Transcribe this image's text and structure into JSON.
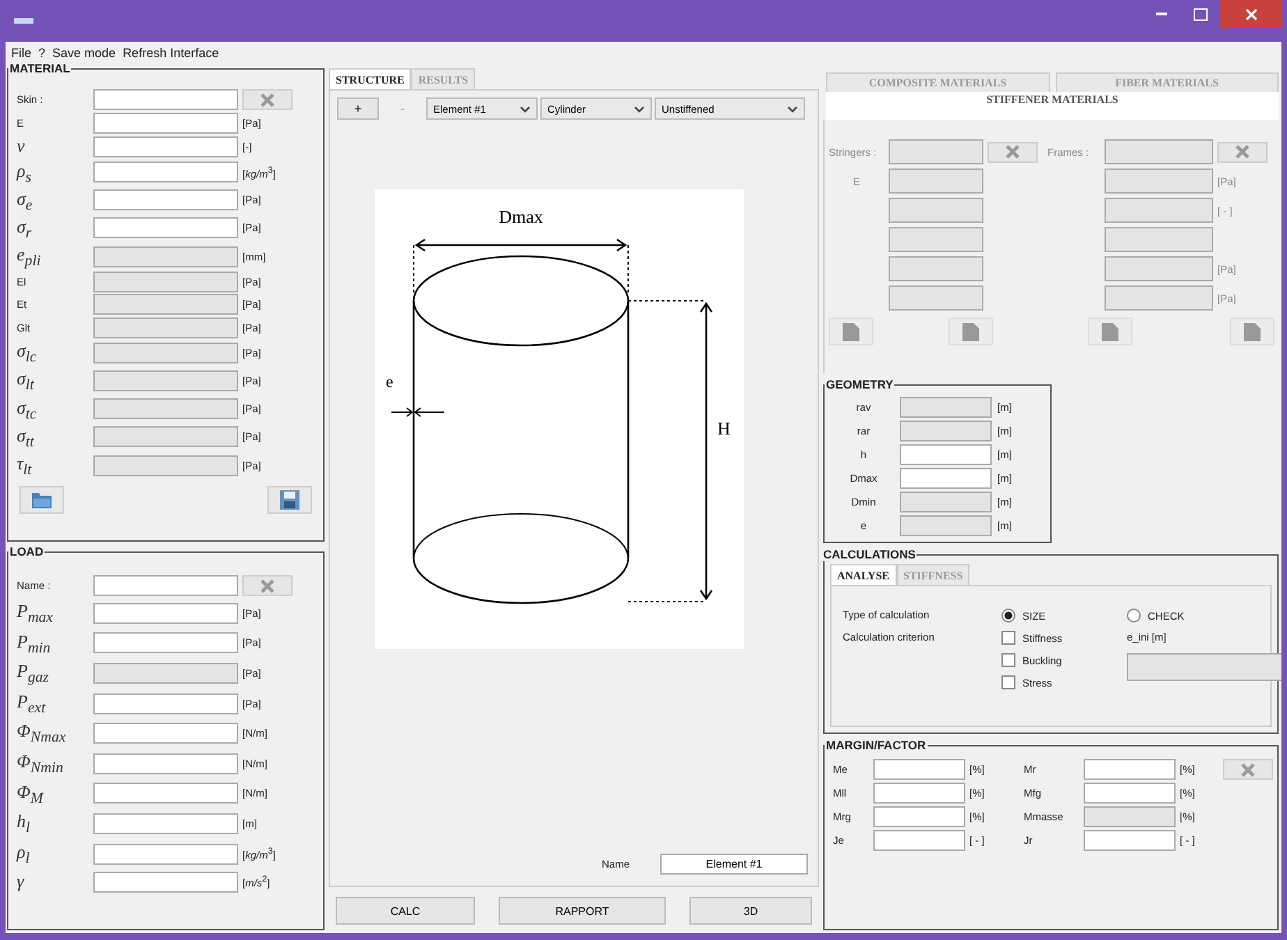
{
  "menu": [
    "File",
    "?",
    "Save mode",
    "Refresh Interface"
  ],
  "material": {
    "title": "MATERIAL",
    "name_label": "Skin :",
    "rows": [
      {
        "label": "E",
        "kind": "plain",
        "unit": "[Pa]",
        "disabled": false
      },
      {
        "label": "ν",
        "kind": "math",
        "unit": "[-]",
        "disabled": false
      },
      {
        "label": "ρ$_{s}$",
        "kind": "math",
        "unit": "[*kg/m*$^{3}$]",
        "disabled": false
      },
      {
        "label": "σ$_{e}$",
        "kind": "math",
        "unit": "[Pa]",
        "disabled": false
      },
      {
        "label": "σ$_{r}$",
        "kind": "math",
        "unit": "[Pa]",
        "disabled": false
      },
      {
        "label": "e$_{pli}$",
        "kind": "math",
        "unit": "[mm]",
        "disabled": true
      },
      {
        "label": "El",
        "kind": "plain",
        "unit": "[Pa]",
        "disabled": true
      },
      {
        "label": "Et",
        "kind": "plain",
        "unit": "[Pa]",
        "disabled": true
      },
      {
        "label": "Glt",
        "kind": "plain",
        "unit": "[Pa]",
        "disabled": true
      },
      {
        "label": "σ$_{lc}$",
        "kind": "math",
        "unit": "[Pa]",
        "disabled": true
      },
      {
        "label": "σ$_{lt}$",
        "kind": "math",
        "unit": "[Pa]",
        "disabled": true
      },
      {
        "label": "σ$_{tc}$",
        "kind": "math",
        "unit": "[Pa]",
        "disabled": true
      },
      {
        "label": "σ$_{tt}$",
        "kind": "math",
        "unit": "[Pa]",
        "disabled": true
      },
      {
        "label": "τ$_{lt}$",
        "kind": "math",
        "unit": "[Pa]",
        "disabled": true
      }
    ]
  },
  "load": {
    "title": "LOAD",
    "name_label": "Name :",
    "rows": [
      {
        "label": "P$_{max}$",
        "kind": "math",
        "unit": "[Pa]",
        "disabled": false
      },
      {
        "label": "P$_{min}$",
        "kind": "math",
        "unit": "[Pa]",
        "disabled": false
      },
      {
        "label": "P$_{gaz}$",
        "kind": "math",
        "unit": "[Pa]",
        "disabled": true
      },
      {
        "label": "P$_{ext}$",
        "kind": "math",
        "unit": "[Pa]",
        "disabled": false
      },
      {
        "label": "Φ$_{Nmax}$",
        "kind": "math",
        "unit": "[N/m]",
        "disabled": false
      },
      {
        "label": "Φ$_{Nmin}$",
        "kind": "math",
        "unit": "[N/m]",
        "disabled": false
      },
      {
        "label": "Φ$_{M}$",
        "kind": "math",
        "unit": "[N/m]",
        "disabled": false
      },
      {
        "label": "h$_{l}$",
        "kind": "math",
        "unit": "[m]",
        "disabled": false
      },
      {
        "label": "ρ$_{l}$",
        "kind": "math",
        "unit": "[*kg/m*$^{3}$]",
        "disabled": false
      },
      {
        "label": "γ",
        "kind": "math",
        "unit": "[*m/s*$^{2}$]",
        "disabled": false
      }
    ]
  },
  "structure": {
    "tabs": [
      {
        "label": "STRUCTURE",
        "selected": true
      },
      {
        "label": "RESULTS",
        "selected": false
      }
    ],
    "tool_buttons": [
      {
        "label": "+",
        "disabled": false
      },
      {
        "label": "-",
        "disabled": true
      }
    ],
    "dropdowns": [
      "Element #1",
      "Cylinder",
      "Unstiffened"
    ],
    "drawing_labels": {
      "width": "Dmax",
      "thickness": "e",
      "height": "H"
    },
    "name_label": "Name",
    "name_value": "Element #1",
    "buttons": [
      "CALC",
      "RAPPORT",
      "3D"
    ]
  },
  "materials_tabs": [
    {
      "label": "COMPOSITE MATERIALS",
      "selected": false
    },
    {
      "label": "FIBER MATERIALS",
      "selected": false
    },
    {
      "label": "STIFFENER MATERIALS",
      "selected": true
    }
  ],
  "stiffener": {
    "left_label": "Stringers :",
    "right_label": "Frames :",
    "rows": [
      {
        "label": "E",
        "unit": "[Pa]"
      },
      {
        "unit": "[ - ]"
      },
      {},
      {
        "unit": "[Pa]"
      },
      {
        "unit": "[Pa]"
      }
    ]
  },
  "geometry": {
    "title": "GEOMETRY",
    "rows": [
      {
        "label": "rav",
        "unit": "[m]",
        "disabled": true
      },
      {
        "label": "rar",
        "unit": "[m]",
        "disabled": true
      },
      {
        "label": "h",
        "unit": "[m]",
        "disabled": false
      },
      {
        "label": "Dmax",
        "unit": "[m]",
        "disabled": false
      },
      {
        "label": "Dmin",
        "unit": "[m]",
        "disabled": true
      },
      {
        "label": "e",
        "unit": "[m]",
        "disabled": true
      }
    ]
  },
  "calculations": {
    "title": "CALCULATIONS",
    "tabs": [
      {
        "label": "ANALYSE",
        "selected": true
      },
      {
        "label": "STIFFNESS",
        "selected": false
      }
    ],
    "type_label": "Type of calculation",
    "radios": [
      {
        "label": "SIZE",
        "selected": true
      },
      {
        "label": "CHECK",
        "selected": false
      }
    ],
    "criterion_label": "Calculation criterion",
    "checks": [
      {
        "label": "Stiffness",
        "checked": false
      },
      {
        "label": "Buckling",
        "checked": false
      },
      {
        "label": "Stress",
        "checked": false
      }
    ],
    "e_ini_label": "e_ini [m]"
  },
  "margin": {
    "title": "MARGIN/FACTOR",
    "left": [
      {
        "label": "Me",
        "unit": "[%]",
        "disabled": false
      },
      {
        "label": "Mll",
        "unit": "[%]",
        "disabled": false
      },
      {
        "label": "Mrg",
        "unit": "[%]",
        "disabled": false
      },
      {
        "label": "Je",
        "unit": "[ - ]",
        "disabled": false
      }
    ],
    "right": [
      {
        "label": "Mr",
        "unit": "[%]",
        "disabled": false
      },
      {
        "label": "Mfg",
        "unit": "[%]",
        "disabled": false
      },
      {
        "label": "Mmasse",
        "unit": "[%]",
        "disabled": true
      },
      {
        "label": "Jr",
        "unit": "[ - ]",
        "disabled": false
      }
    ]
  }
}
